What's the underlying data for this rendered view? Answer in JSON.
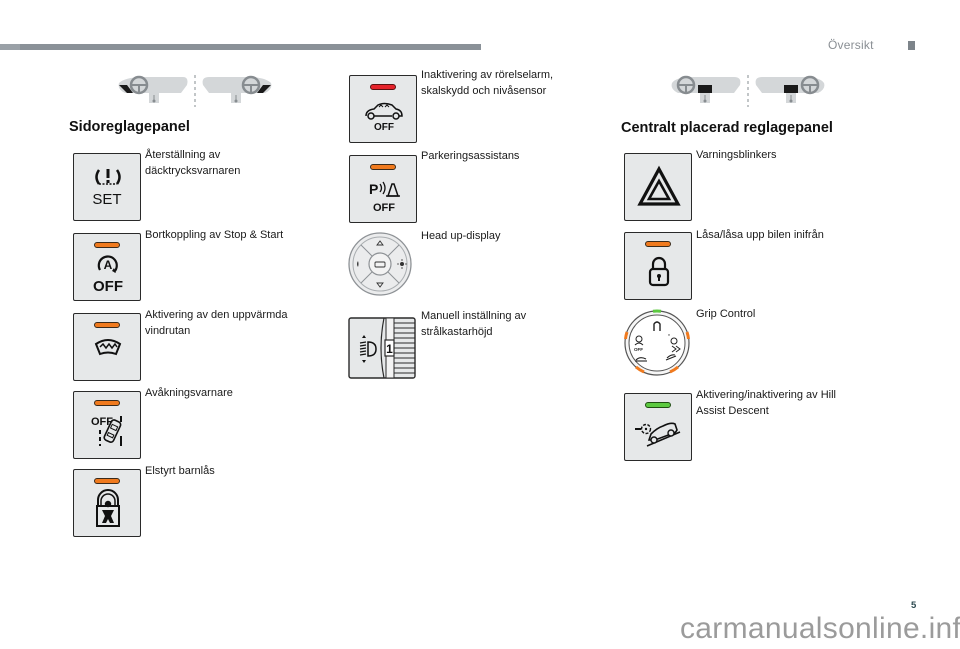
{
  "header": {
    "section_title": "Översikt"
  },
  "colors": {
    "led_orange": "#f07a1e",
    "led_red": "#e5232b",
    "led_green": "#5cc940",
    "button_face": "#e6e8e9",
    "top_bar": "#8a9198"
  },
  "side_panel": {
    "heading": "Sidoreglagepanel",
    "items": [
      {
        "label_line1": "Återställning av",
        "label_line2": "däcktrycksvarnaren",
        "icon": "tyre-pressure-set-icon",
        "icon_text": "SET",
        "led": "none"
      },
      {
        "label_line1": "Bortkoppling av Stop & Start",
        "label_line2": "",
        "icon": "stop-start-off-icon",
        "icon_text": "OFF",
        "icon_letter": "A",
        "led": "orange"
      },
      {
        "label_line1": "Aktivering av den uppvärmda",
        "label_line2": "vindrutan",
        "icon": "heated-windscreen-icon",
        "led": "orange"
      },
      {
        "label_line1": "Avåkningsvarnare",
        "label_line2": "",
        "icon": "lane-departure-off-icon",
        "icon_text": "OFF",
        "led": "orange"
      },
      {
        "label_line1": "Elstyrt barnlås",
        "label_line2": "",
        "icon": "child-lock-icon",
        "led": "orange"
      }
    ]
  },
  "middle_column": {
    "items": [
      {
        "label_line1": "Inaktivering av rörelselarm,",
        "label_line2": "skalskydd och nivåsensor",
        "icon": "alarm-off-icon",
        "icon_text": "OFF",
        "led": "red"
      },
      {
        "label_line1": "Parkeringsassistans",
        "label_line2": "",
        "icon": "park-assist-off-icon",
        "icon_text": "OFF",
        "icon_letter": "P",
        "led": "orange"
      },
      {
        "label_line1": "Head up-display",
        "label_line2": "",
        "icon": "head-up-display-control-icon"
      },
      {
        "label_line1": "Manuell inställning av",
        "label_line2": "strålkastarhöjd",
        "icon": "headlamp-height-dial-icon",
        "icon_text": "1"
      }
    ]
  },
  "central_panel": {
    "heading": "Centralt placerad reglagepanel",
    "items": [
      {
        "label_line1": "Varningsblinkers",
        "label_line2": "",
        "icon": "hazard-warning-icon",
        "led": "none"
      },
      {
        "label_line1": "Låsa/låsa upp bilen inifrån",
        "label_line2": "",
        "icon": "central-lock-icon",
        "led": "orange"
      },
      {
        "label_line1": "Grip Control",
        "label_line2": "",
        "icon": "grip-control-dial-icon"
      },
      {
        "label_line1": "Aktivering/inaktivering av Hill",
        "label_line2": "Assist Descent",
        "icon": "hill-descent-icon",
        "led": "green"
      }
    ]
  },
  "footer": {
    "page_number": "5",
    "watermark": "carmanualsonline.info"
  }
}
